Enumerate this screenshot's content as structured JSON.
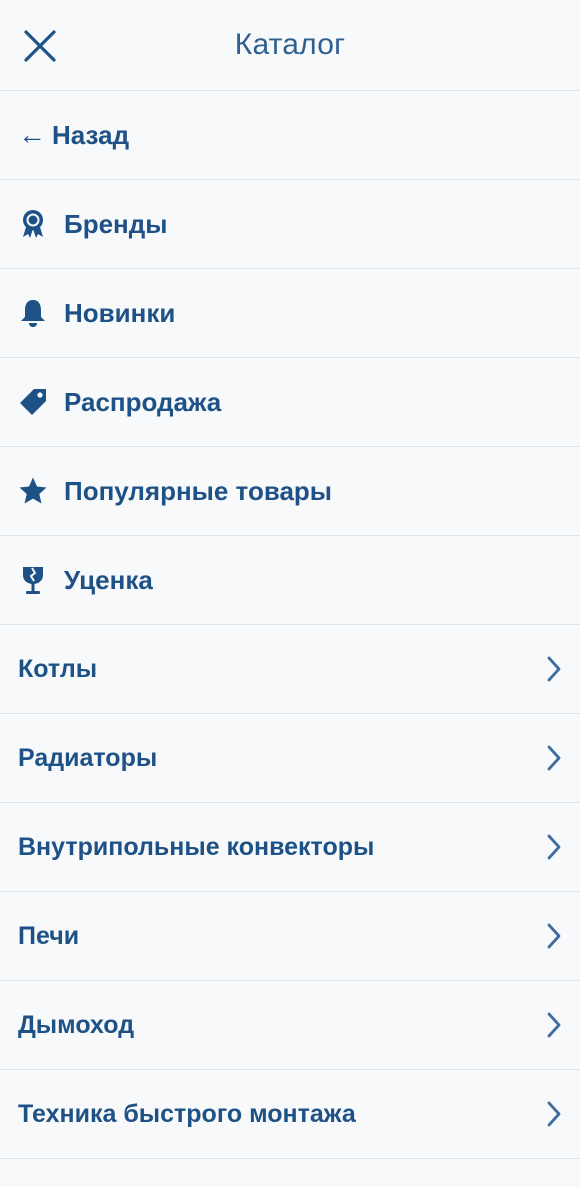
{
  "header": {
    "title": "Каталог",
    "close_icon": "close-icon"
  },
  "back": {
    "arrow": "←",
    "label": "Назад"
  },
  "special_items": [
    {
      "label": "Бренды",
      "icon": "badge-icon"
    },
    {
      "label": "Новинки",
      "icon": "bell-icon"
    },
    {
      "label": "Распродажа",
      "icon": "tag-icon"
    },
    {
      "label": "Популярные товары",
      "icon": "star-icon"
    },
    {
      "label": "Уценка",
      "icon": "broken-glass-icon"
    }
  ],
  "categories": [
    {
      "label": "Котлы",
      "icon": "chevron-right-icon"
    },
    {
      "label": "Радиаторы",
      "icon": "chevron-right-icon"
    },
    {
      "label": "Внутрипольные конвекторы",
      "icon": "chevron-right-icon"
    },
    {
      "label": "Печи",
      "icon": "chevron-right-icon"
    },
    {
      "label": "Дымоход",
      "icon": "chevron-right-icon"
    },
    {
      "label": "Техника быстрого монтажа",
      "icon": "chevron-right-icon"
    }
  ],
  "colors": {
    "background": "#f8f9fa",
    "text": "#1e5287",
    "chevron": "#3e6e9e",
    "divider": "#dfe4ea"
  }
}
